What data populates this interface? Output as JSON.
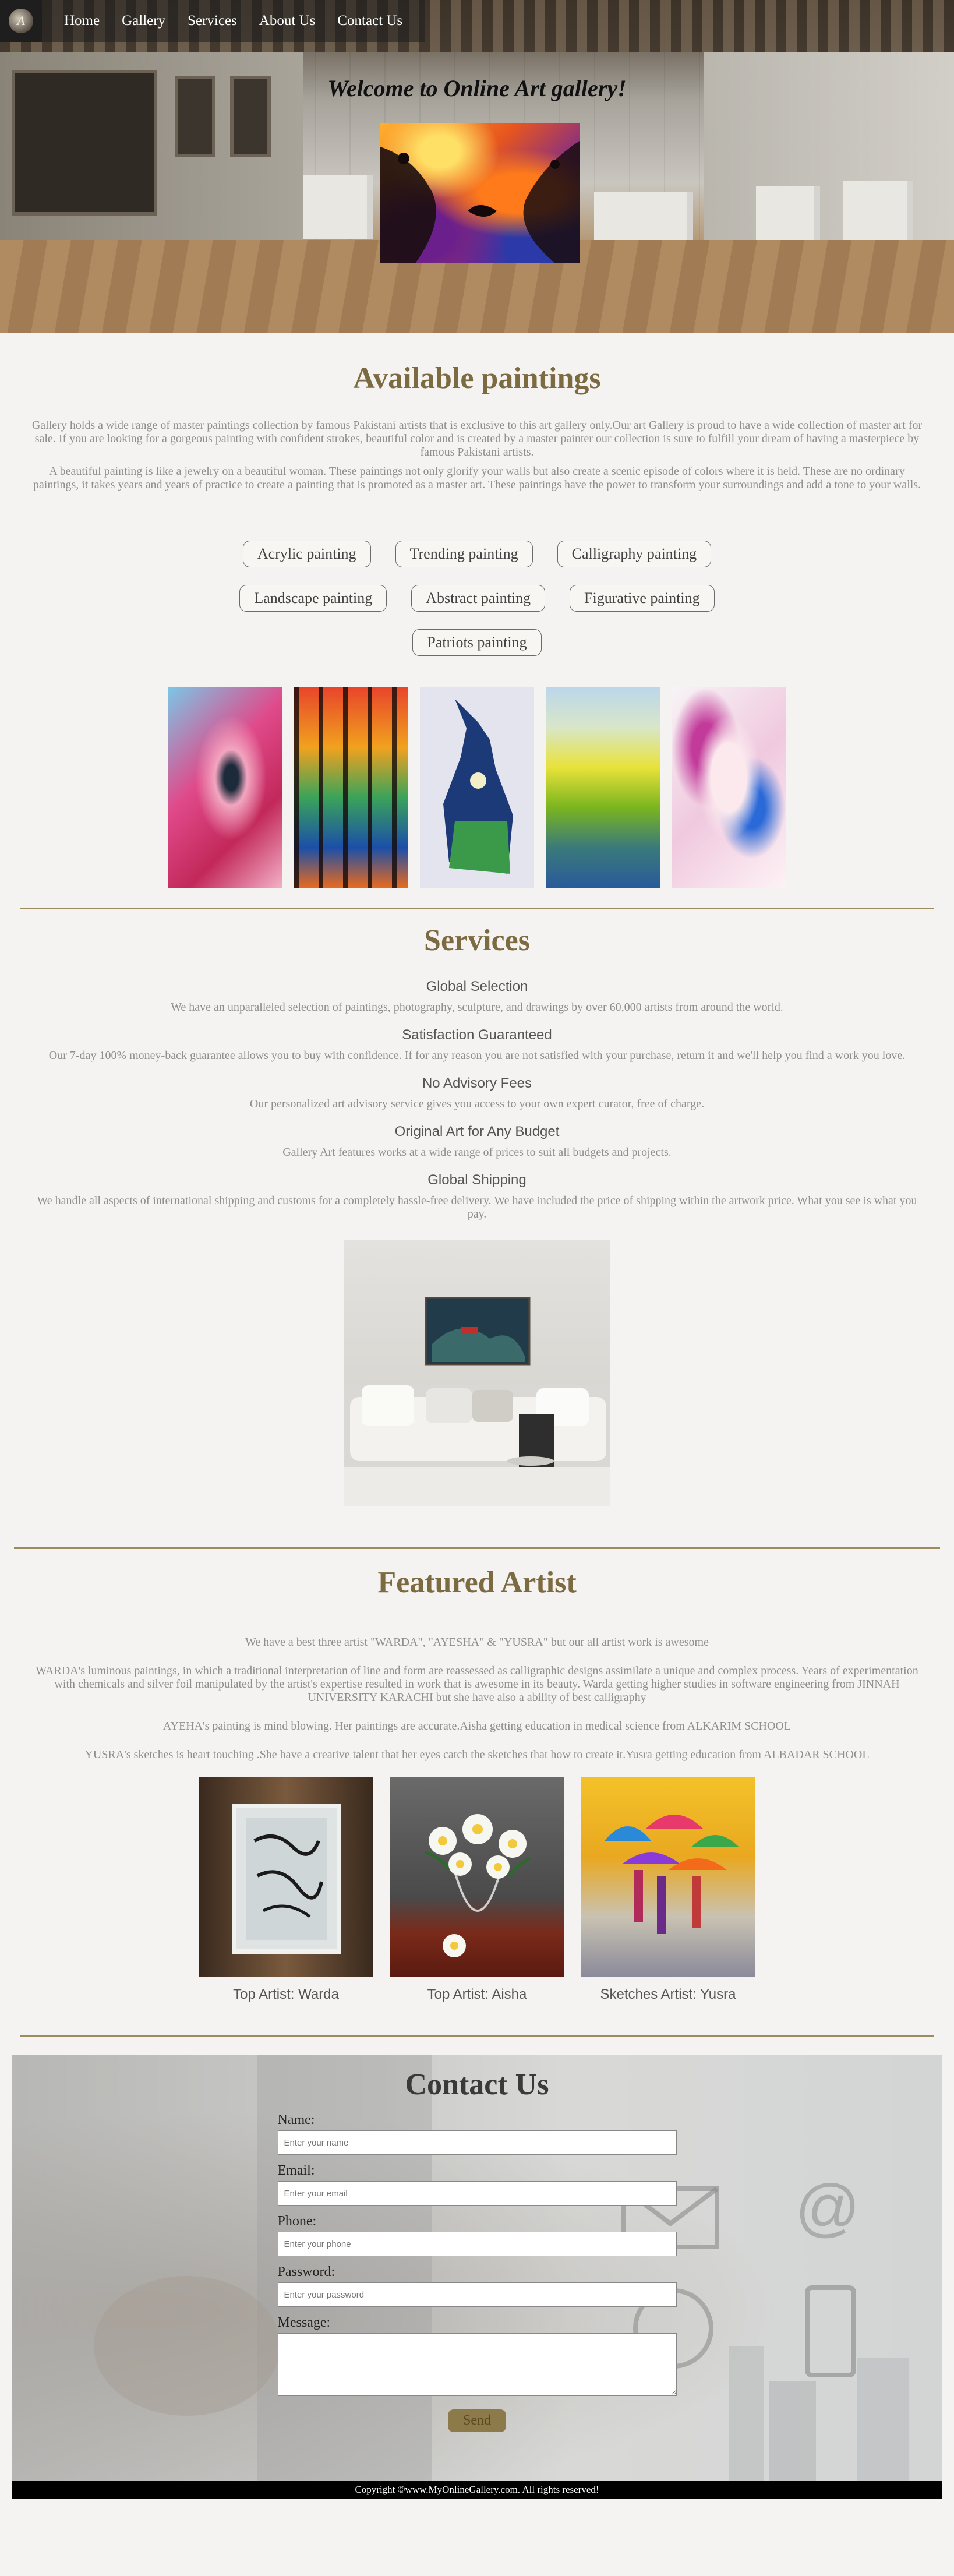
{
  "nav": {
    "logo_text": "A",
    "links": [
      "Home",
      "Gallery",
      "Services",
      "About Us",
      "Contact Us"
    ]
  },
  "hero": {
    "title": "Welcome to Online Art gallery!"
  },
  "available": {
    "title": "Available paintings",
    "p1": "Gallery holds a wide range of master paintings collection by famous Pakistani artists that is exclusive to this art gallery only.Our art Gallery is proud to have a wide collection of master art for sale. If you are looking for a gorgeous painting with confident strokes, beautiful color and is created by a master painter our collection is sure to fulfill your dream of having a masterpiece by famous Pakistani artists.",
    "p2": "A beautiful painting is like a jewelry on a beautiful woman. These paintings not only glorify your walls but also create a scenic episode of colors where it is held. These are no ordinary paintings, it takes years and years of practice to create a painting that is promoted as a master art. These paintings have the power to transform your surroundings and add a tone to your walls.",
    "categories": [
      "Acrylic painting",
      "Trending painting",
      "Calligraphy painting",
      "Landscape painting",
      "Abstract painting",
      "Figurative painting",
      "Patriots painting"
    ]
  },
  "services": {
    "title": "Services",
    "items": [
      {
        "heading": "Global Selection",
        "text": "We have an unparalleled selection of paintings, photography, sculpture, and drawings by over 60,000 artists from around the world."
      },
      {
        "heading": "Satisfaction Guaranteed",
        "text": "Our 7-day 100% money-back guarantee allows you to buy with confidence. If for any reason you are not satisfied with your purchase, return it and we'll help you find a work you love."
      },
      {
        "heading": "No Advisory Fees",
        "text": "Our personalized art advisory service gives you access to your own expert curator, free of charge."
      },
      {
        "heading": "Original Art for Any Budget",
        "text": "Gallery Art features works at a wide range of prices to suit all budgets and projects."
      },
      {
        "heading": "Global Shipping",
        "text": "We handle all aspects of international shipping and customs for a completely hassle-free delivery. We have included the price of shipping within the artwork price. What you see is what you pay."
      }
    ]
  },
  "featured": {
    "title": "Featured Artist",
    "p1": "We have a best three artist \"WARDA\", \"AYESHA\" & \"YUSRA\" but our all artist work is awesome",
    "p2": "WARDA's luminous paintings, in which a traditional interpretation of line and form are reassessed as calligraphic designs assimilate a unique and complex process. Years of experimentation with chemicals and silver foil manipulated by the artist's expertise resulted in work that is awesome in its beauty. Warda getting higher studies in software engineering from JINNAH UNIVERSITY KARACHI but she have also a ability of best calligraphy",
    "p3": "AYEHA's painting is mind blowing. Her paintings are accurate.Aisha getting education in medical science from ALKARIM SCHOOL",
    "p4": "YUSRA's sketches is heart touching .She have a creative talent that her eyes catch the sketches that how to create it.Yusra getting education from ALBADAR SCHOOL",
    "artists": [
      {
        "caption": "Top Artist: Warda"
      },
      {
        "caption": "Top Artist: Aisha"
      },
      {
        "caption": "Sketches Artist: Yusra"
      }
    ]
  },
  "contact": {
    "title": "Contact Us",
    "name_label": "Name:",
    "name_placeholder": "Enter your name",
    "email_label": "Email:",
    "email_placeholder": "Enter your email",
    "phone_label": "Phone:",
    "phone_placeholder": "Enter your phone",
    "password_label": "Password:",
    "password_placeholder": "Enter your password",
    "message_label": "Message:",
    "send_label": "Send"
  },
  "footer": {
    "text": "Copyright ©www.MyOnlineGallery.com. All rights reserved!"
  }
}
